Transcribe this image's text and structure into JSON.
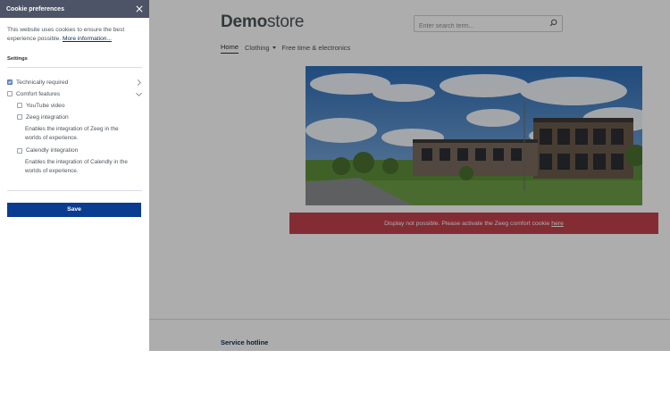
{
  "store": {
    "logo_bold": "Demo",
    "logo_rest": "store",
    "search_placeholder": "Enter search term...",
    "nav": [
      {
        "label": "Home",
        "active": true
      },
      {
        "label": "Clothing",
        "active": false
      },
      {
        "label": "Free time & electronics",
        "active": false
      }
    ],
    "alert_text": "Display not possible. Please activate the Zeeg comfort cookie",
    "alert_link": "here",
    "service_hotline": "Service hotline"
  },
  "cookie_panel": {
    "title": "Cookie preferences",
    "description": "This website uses cookies to ensure the best experience possible.",
    "more_info_link": "More information...",
    "settings_heading": "Settings",
    "technically_required": "Technically required",
    "comfort_features": "Comfort features",
    "youtube": "YouTube video",
    "zeeg": "Zeeg integration",
    "zeeg_desc": "Enables the integration of Zeeg in the worlds of experience.",
    "calendly": "Calendly integration",
    "calendly_desc": "Enables the integration of Calendly in the worlds of experience.",
    "save_label": "Save"
  },
  "colors": {
    "panel_header": "#4d5467",
    "save_button": "#0a3d91",
    "alert": "#c2414d",
    "checkbox_checked": "#6a8fd6",
    "hotline": "#0b2c54"
  }
}
